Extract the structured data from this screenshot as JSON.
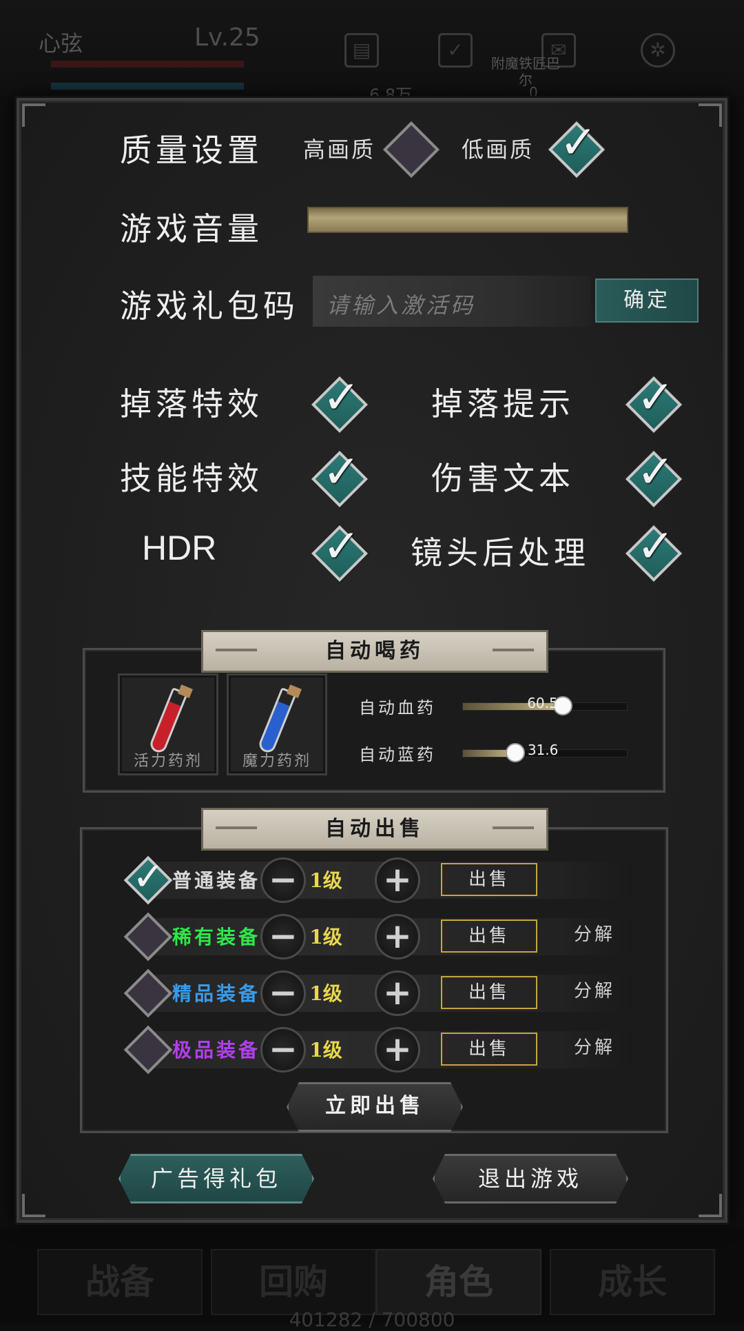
{
  "hud": {
    "player_name": "心弦",
    "level": "Lv.25",
    "gold": "6.8万",
    "map_label": "附魔铁匠巴尔",
    "map_count": "0",
    "exp": "401282 / 700800"
  },
  "nav": {
    "tabs": [
      {
        "label": "战备"
      },
      {
        "label": "回购"
      },
      {
        "label": "角色"
      },
      {
        "label": "成长"
      }
    ]
  },
  "settings": {
    "quality": {
      "label": "质量设置",
      "high_label": "高画质",
      "high_checked": false,
      "low_label": "低画质",
      "low_checked": true
    },
    "volume": {
      "label": "游戏音量",
      "value": 1.0
    },
    "giftcode": {
      "label": "游戏礼包码",
      "placeholder": "请输入激活码",
      "confirm_label": "确定"
    },
    "toggles": [
      {
        "label": "掉落特效",
        "checked": true
      },
      {
        "label": "掉落提示",
        "checked": true
      },
      {
        "label": "技能特效",
        "checked": true
      },
      {
        "label": "伤害文本",
        "checked": true
      },
      {
        "label": "HDR",
        "checked": true
      },
      {
        "label": "镜头后处理",
        "checked": true
      }
    ]
  },
  "auto_potion": {
    "title": "自动喝药",
    "potions": [
      {
        "name": "活力药剂",
        "color": "#c8202a"
      },
      {
        "name": "魔力药剂",
        "color": "#2a5fd0"
      }
    ],
    "hp": {
      "label": "自动血药",
      "value": "60.5",
      "fraction": 0.605
    },
    "mp": {
      "label": "自动蓝药",
      "value": "31.6",
      "fraction": 0.316
    }
  },
  "auto_sell": {
    "title": "自动出售",
    "rows": [
      {
        "label": "普通装备",
        "color": "#d8d8d8",
        "checked": true,
        "level": "1级",
        "sell": "出售",
        "decompose": ""
      },
      {
        "label": "稀有装备",
        "color": "#2ee84a",
        "checked": false,
        "level": "1级",
        "sell": "出售",
        "decompose": "分解"
      },
      {
        "label": "精品装备",
        "color": "#3a9ae8",
        "checked": false,
        "level": "1级",
        "sell": "出售",
        "decompose": "分解"
      },
      {
        "label": "极品装备",
        "color": "#b040e8",
        "checked": false,
        "level": "1级",
        "sell": "出售",
        "decompose": "分解"
      }
    ],
    "sell_now": "立即出售"
  },
  "footer": {
    "ad_gift": "广告得礼包",
    "exit": "退出游戏"
  }
}
